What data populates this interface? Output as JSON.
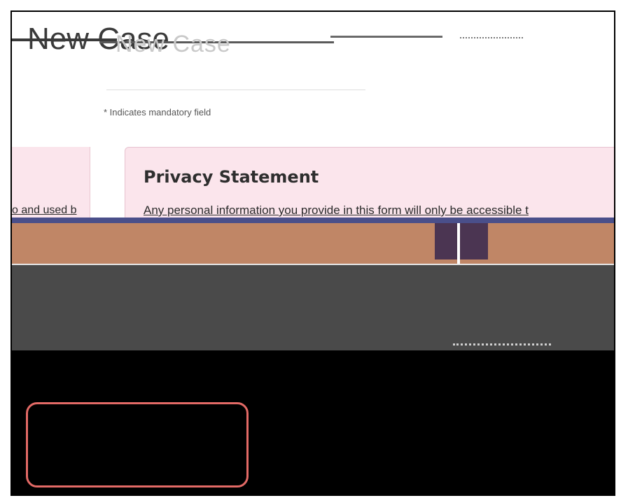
{
  "page": {
    "title": "New Case",
    "title_ghost": "New Case",
    "mandatory_note": "* Indicates mandatory field"
  },
  "privacy": {
    "heading": "Privacy Statement",
    "body": "Any personal information you provide in this form will only be accessible t",
    "left_text": "o and used b"
  },
  "colors": {
    "panel_bg": "#fbe5ec",
    "highlight": "#e36a66"
  }
}
